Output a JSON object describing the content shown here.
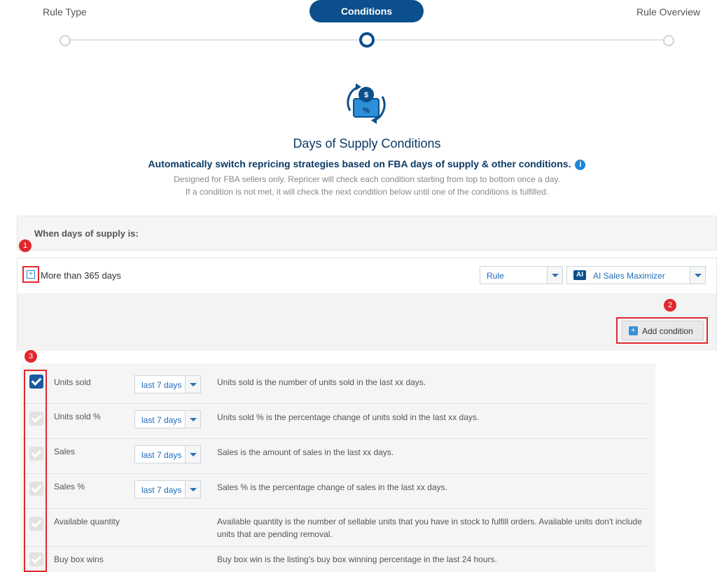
{
  "stepper": {
    "steps": [
      "Rule Type",
      "Conditions",
      "Rule Overview"
    ],
    "active": "Conditions"
  },
  "header": {
    "title": "Days of Supply Conditions",
    "subtitle": "Automatically switch repricing strategies based on FBA days of supply & other conditions.",
    "description_line1": "Designed for FBA sellers only. Repricer will check each condition starting from top to bottom once a day.",
    "description_line2": "If a condition is not met, it will check the next condition below until one of the conditions is fulfilled."
  },
  "panel": {
    "heading": "When days of supply is:",
    "condition_label": "More than 365 days",
    "rule_select": "Rule",
    "strategy_badge": "AI",
    "strategy_select": "AI Sales Maximizer",
    "add_condition_label": "Add condition"
  },
  "annotations": [
    "1",
    "2",
    "3"
  ],
  "conditions": [
    {
      "name": "Units sold",
      "checked": true,
      "period": "last 7 days",
      "description": "Units sold is the number of units sold in the last xx days."
    },
    {
      "name": "Units sold %",
      "checked": false,
      "period": "last 7 days",
      "description": "Units sold % is the percentage change of units sold in the last xx days."
    },
    {
      "name": "Sales",
      "checked": false,
      "period": "last 7 days",
      "description": "Sales is the amount of sales in the last xx days."
    },
    {
      "name": "Sales %",
      "checked": false,
      "period": "last 7 days",
      "description": "Sales % is the percentage change of sales in the last xx days."
    },
    {
      "name": "Available quantity",
      "checked": false,
      "period": null,
      "description": "Available quantity is the number of sellable units that you have in stock to fulfill orders. Available units don't include units that are pending removal."
    },
    {
      "name": "Buy box wins",
      "checked": false,
      "period": null,
      "description": "Buy box win is the listing's buy box winning percentage in the last 24 hours."
    }
  ],
  "colors": {
    "primary": "#0b4f8c",
    "accent": "#1e88d8",
    "highlight": "#e0282e"
  }
}
